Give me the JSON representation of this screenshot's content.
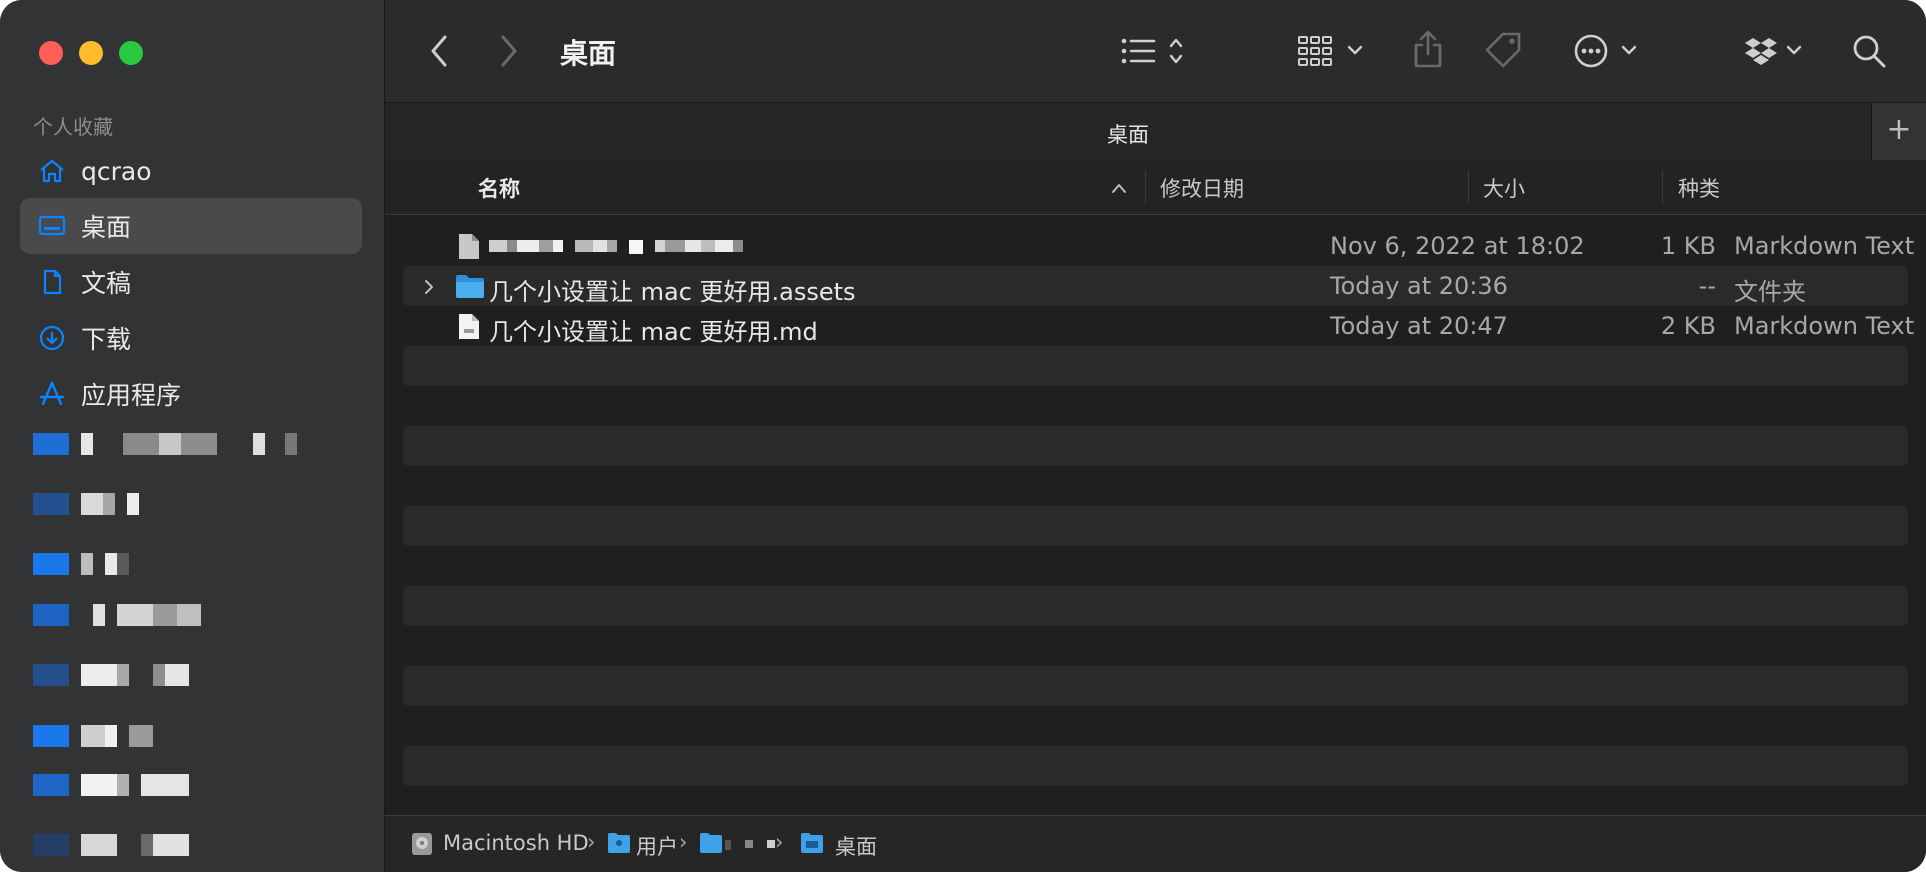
{
  "window": {
    "title": "桌面"
  },
  "sidebar": {
    "section": "个人收藏",
    "items": [
      {
        "label": "qcrao",
        "icon": "home-icon"
      },
      {
        "label": "桌面",
        "icon": "desktop-icon"
      },
      {
        "label": "文稿",
        "icon": "document-icon"
      },
      {
        "label": "下载",
        "icon": "download-icon"
      },
      {
        "label": "应用程序",
        "icon": "applications-icon"
      }
    ]
  },
  "toolbar": {
    "title": "桌面",
    "back_icon": "chevron-left-icon",
    "forward_icon": "chevron-right-icon"
  },
  "tab": {
    "label": "桌面",
    "add": "+"
  },
  "columns": {
    "name": "名称",
    "modified": "修改日期",
    "size": "大小",
    "kind": "种类"
  },
  "files": [
    {
      "name": "",
      "modified": "Nov 6, 2022 at 18:02",
      "size": "1 KB",
      "kind": "Markdown Text"
    },
    {
      "name": "几个小设置让 mac 更好用.assets",
      "modified": "Today at 20:36",
      "size": "--",
      "kind": "文件夹"
    },
    {
      "name": "几个小设置让 mac 更好用.md",
      "modified": "Today at 20:47",
      "size": "2 KB",
      "kind": "Markdown Text"
    }
  ],
  "path": {
    "disk": "Macintosh HD",
    "users": "用户",
    "current": "桌面"
  },
  "colors": {
    "accent": "#0a84ff",
    "folder": "#3fa2e8",
    "close": "#fe5f57",
    "minimize": "#febc2e",
    "zoom": "#28c840"
  }
}
